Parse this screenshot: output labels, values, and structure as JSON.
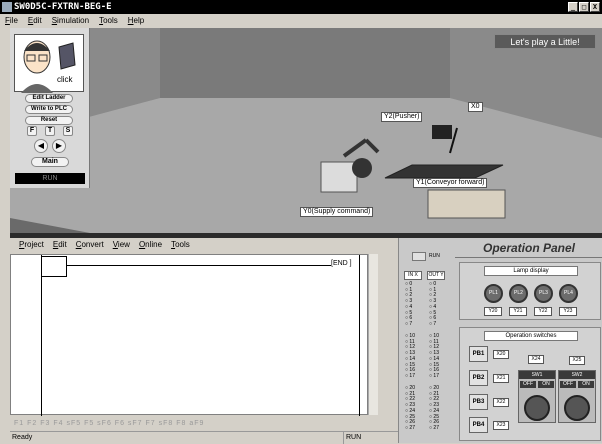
{
  "window": {
    "title": "SW0D5C-FXTRN-BEG-E",
    "buttons": [
      "_",
      "□",
      "X"
    ]
  },
  "menubar": {
    "items": [
      "File",
      "Edit",
      "Simulation",
      "Tools",
      "Help"
    ]
  },
  "left_panel": {
    "click_label": "click",
    "buttons": {
      "edit_ladder": "Edit Ladder",
      "write_to_plc": "Write to PLC",
      "reset": "Reset"
    },
    "fts": [
      "F",
      "T",
      "S"
    ],
    "main": "Main",
    "status": "RUN"
  },
  "scene": {
    "play_label": "Let's play a Little!",
    "labels": {
      "pusher": "Y2(Pusher)",
      "sensor": "X0",
      "conveyor": "Y1(Conveyor forward)",
      "supply": "Y0(Supply command)"
    }
  },
  "editor": {
    "menu": [
      "Project",
      "Edit",
      "Convert",
      "View",
      "Online",
      "Tools"
    ],
    "end_text": "[END ]",
    "toolbar": "F1  F2  F3  F4  sF5 F5  sF6 F6  sF7 F7  sF8 F8  aF9",
    "status_left": "Ready",
    "status_mode": "RUN"
  },
  "operation_panel": {
    "title": "Operation Panel",
    "run_label": "RUN",
    "in_header": "IN X",
    "out_header": "OUT Y",
    "io_groups": [
      [
        "0",
        "1",
        "2",
        "3",
        "4",
        "5",
        "6",
        "7"
      ],
      [
        "10",
        "11",
        "12",
        "13",
        "14",
        "15",
        "16",
        "17"
      ],
      [
        "20",
        "21",
        "22",
        "23",
        "24",
        "25",
        "26",
        "27"
      ]
    ],
    "lamp_display_label": "Lamp display",
    "lamps": [
      "PL1",
      "PL2",
      "PL3",
      "PL4"
    ],
    "lamp_outputs": [
      "Y20",
      "Y21",
      "Y22",
      "Y23"
    ],
    "switches_label": "Operation switches",
    "push_buttons": [
      "PB1",
      "PB2",
      "PB3",
      "PB4"
    ],
    "pb_inputs": [
      "X20",
      "X21",
      "X22",
      "X23"
    ],
    "selector_inputs": [
      "X24",
      "X25"
    ],
    "selectors": [
      "SW1",
      "SW2"
    ],
    "off": "OFF",
    "on": "ON"
  }
}
